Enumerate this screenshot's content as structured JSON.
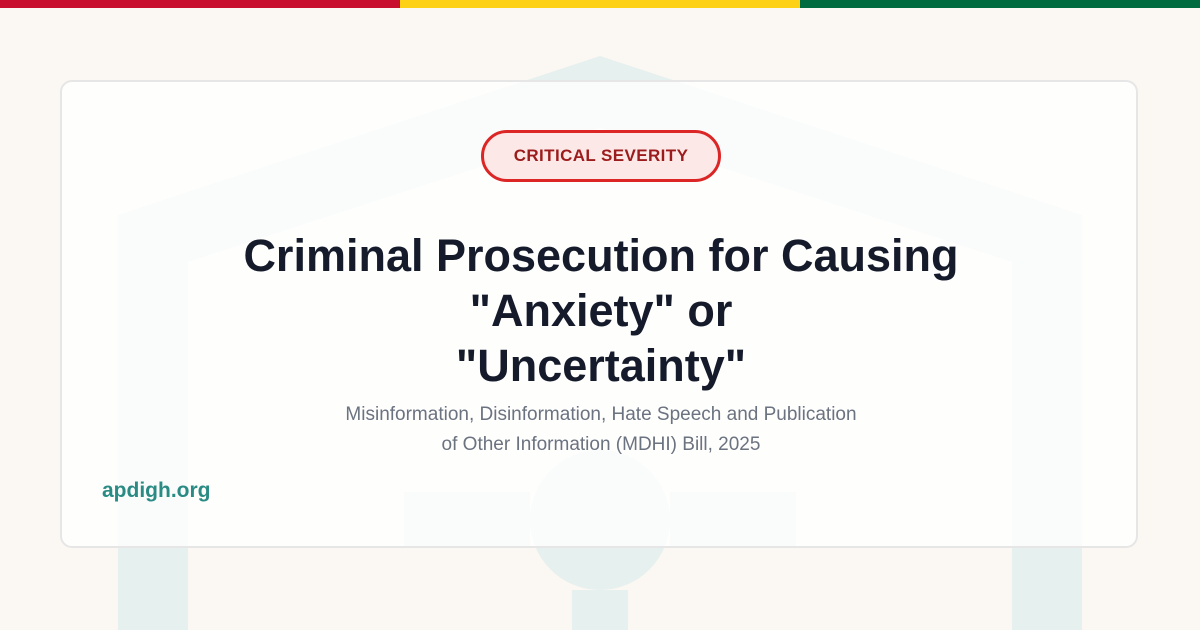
{
  "colors": {
    "stripe_red": "#c8102e",
    "stripe_yellow": "#fcd116",
    "stripe_green": "#006b3f",
    "page_bg": "#fbf8f3",
    "watermark": "#e6f0ef",
    "badge_text": "#9b1c1c",
    "badge_border": "#dc2626",
    "badge_bg": "#fde8e8",
    "title": "#151b2b",
    "subtitle": "#6b7280",
    "link": "#2a8b85"
  },
  "badge": {
    "label": "CRITICAL SEVERITY"
  },
  "title": {
    "text": "Criminal Prosecution for Causing\n\"Anxiety\" or\n\"Uncertainty\""
  },
  "subtitle": {
    "text": "Misinformation, Disinformation, Hate Speech and Publication\nof Other Information (MDHI) Bill, 2025"
  },
  "site": {
    "link_text": "apdigh.org"
  },
  "icons": {
    "background": "house-watermark-icon"
  }
}
